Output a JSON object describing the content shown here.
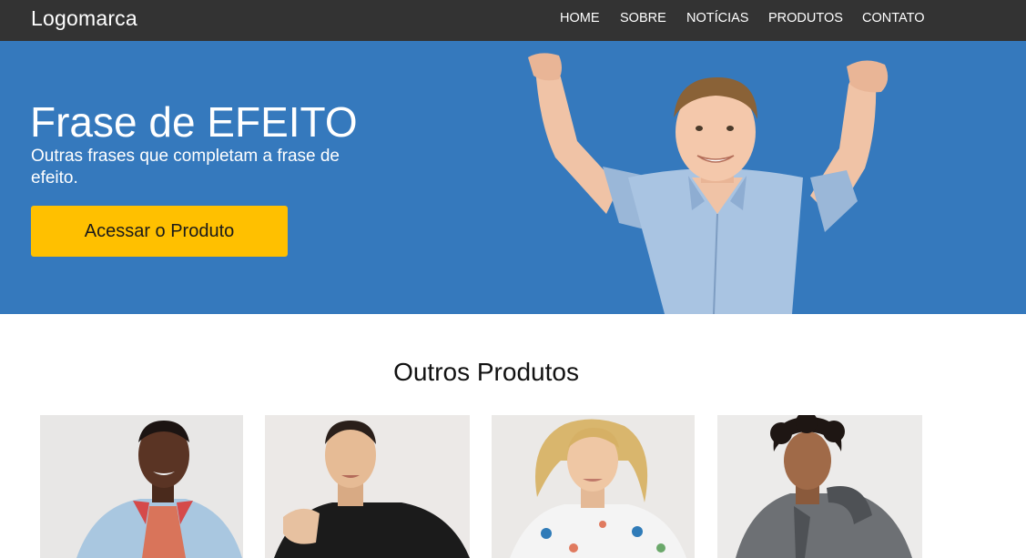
{
  "header": {
    "logo": "Logomarca",
    "nav": [
      {
        "label": "HOME"
      },
      {
        "label": "SOBRE"
      },
      {
        "label": "NOTÍCIAS"
      },
      {
        "label": "PRODUTOS"
      },
      {
        "label": "CONTATO"
      }
    ]
  },
  "hero": {
    "title": "Frase de EFEITO",
    "subtitle": "Outras frases que completam a frase de efeito.",
    "cta_label": "Acessar o Produto",
    "photo": "man-celebrating-arms-raised"
  },
  "products": {
    "title": "Outros Produtos",
    "items": [
      {
        "photo": "model-bomber-jacket"
      },
      {
        "photo": "model-black-tshirt"
      },
      {
        "photo": "model-floral-shirt"
      },
      {
        "photo": "model-grey-hoodie"
      }
    ]
  },
  "colors": {
    "topbar": "#333333",
    "hero_background": "#3579bd",
    "cta_background": "#ffc000"
  }
}
